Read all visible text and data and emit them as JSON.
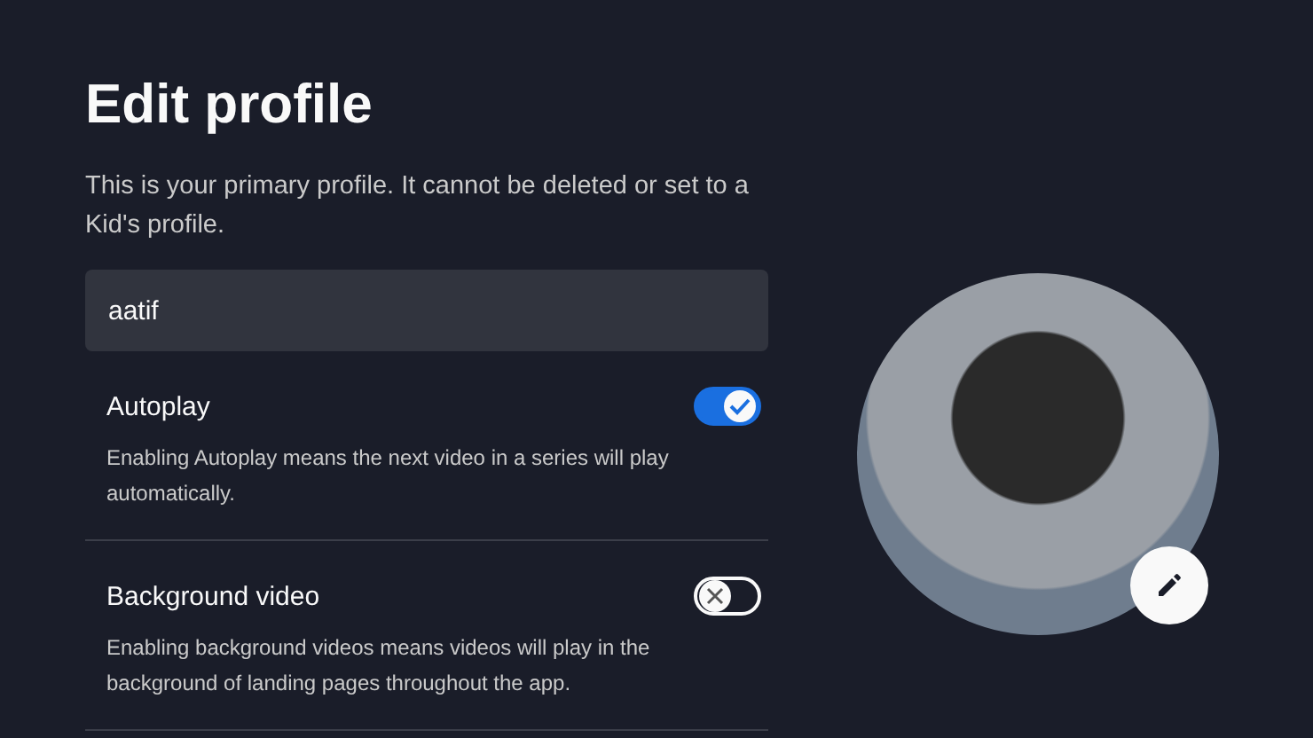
{
  "title": "Edit profile",
  "subtitle": "This is your primary profile. It cannot be deleted or set to a Kid's profile.",
  "name_field": {
    "value": "aatif"
  },
  "settings": [
    {
      "label": "Autoplay",
      "on": true,
      "description": "Enabling Autoplay means the next video in a series will play automatically."
    },
    {
      "label": "Background video",
      "on": false,
      "description": "Enabling background videos means videos will play in the background of landing pages throughout the app."
    }
  ]
}
